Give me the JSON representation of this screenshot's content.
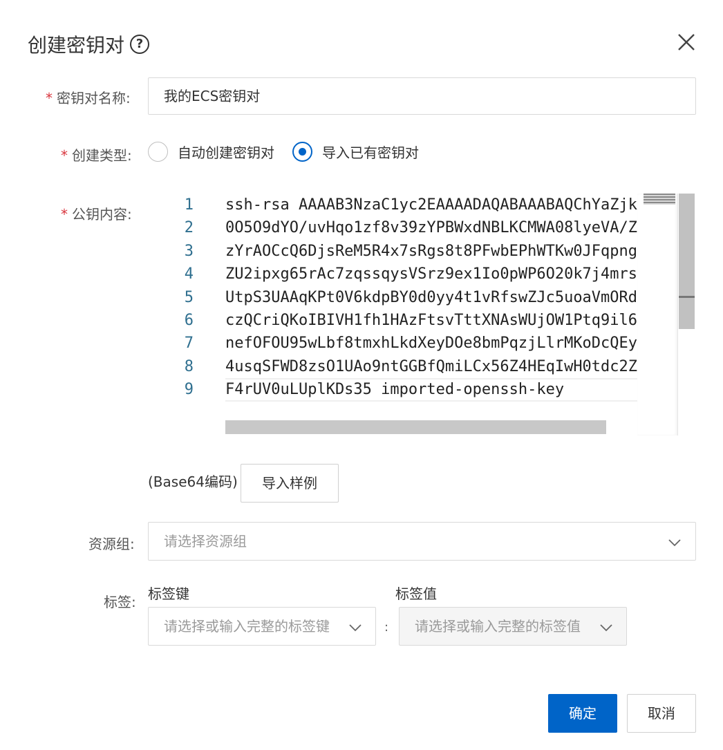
{
  "dialog": {
    "title": "创建密钥对",
    "help_icon_glyph": "?"
  },
  "form": {
    "name_label": "密钥对名称:",
    "name_value": "我的ECS密钥对",
    "type_label": "创建类型:",
    "type_options": [
      {
        "label": "自动创建密钥对",
        "checked": false
      },
      {
        "label": "导入已有密钥对",
        "checked": true
      }
    ],
    "pubkey_label": "公钥内容:",
    "required_mark": "*",
    "pubkey_lines": [
      {
        "num": "1",
        "text": "ssh-rsa AAAAB3NzaC1yc2EAAAADAQABAAABAQChYaZjk"
      },
      {
        "num": "2",
        "text": "0O5O9dYO/uvHqo1zf8v39zYPBWxdNBLKCMWA08lyeVA/Z"
      },
      {
        "num": "3",
        "text": "zYrAOCcQ6DjsReM5R4x7sRgs8t8PFwbEPhWTKw0JFqpng"
      },
      {
        "num": "4",
        "text": "ZU2ipxg65rAc7zqssqysVSrz9ex1Io0pWP6O20k7j4mrs"
      },
      {
        "num": "5",
        "text": "UtpS3UAAqKPt0V6kdpBY0d0yy4t1vRfswZJc5uoaVmORd"
      },
      {
        "num": "6",
        "text": "czQCriQKoIBIVH1fh1HAzFtsvTttXNAsWUjOW1Ptq9il6"
      },
      {
        "num": "7",
        "text": "nefOFOU95wLbf8tmxhLkdXeyDOe8bmPqzjLlrMKoDcQEy"
      },
      {
        "num": "8",
        "text": "4usqSFWD8zsO1UAo9ntGGBfQmiLCx56Z4HEqIwH0tdc2Z"
      },
      {
        "num": "9",
        "text": "F4rUV0uLUplKDs35 imported-openssh-key"
      }
    ],
    "encoding_note": "(Base64编码)",
    "import_sample_button": "导入样例",
    "resource_group_label": "资源组:",
    "resource_group_placeholder": "请选择资源组",
    "tags_label": "标签:",
    "tag_key_label": "标签键",
    "tag_key_placeholder": "请选择或输入完整的标签键",
    "tag_value_label": "标签值",
    "tag_value_placeholder": "请选择或输入完整的标签值",
    "tag_separator": ":"
  },
  "footer": {
    "ok_button": "确定",
    "cancel_button": "取消"
  },
  "colors": {
    "primary": "#0064c8",
    "required": "#d9363e"
  }
}
